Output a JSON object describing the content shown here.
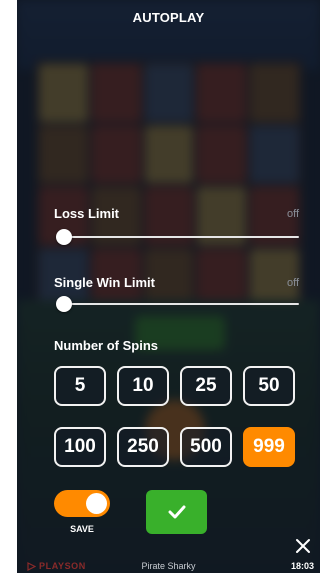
{
  "title": "AUTOPLAY",
  "limits": [
    {
      "label": "Loss Limit",
      "state": "off",
      "value_fraction": 0
    },
    {
      "label": "Single Win Limit",
      "state": "off",
      "value_fraction": 0
    }
  ],
  "spins": {
    "label": "Number of Spins",
    "options": [
      "5",
      "10",
      "25",
      "50",
      "100",
      "250",
      "500",
      "999"
    ],
    "selected": "999"
  },
  "save": {
    "label": "SAVE",
    "enabled": true
  },
  "icons": {
    "confirm": "checkmark-icon",
    "close": "close-icon",
    "brand": "playson-logo-icon"
  },
  "footer": {
    "brand": "PLAYSON",
    "game_name": "Pirate Sharky",
    "clock": "18:03"
  },
  "colors": {
    "accent_orange": "#ff8a00",
    "confirm_green": "#39b02b",
    "muted_text": "#8a8f99"
  }
}
